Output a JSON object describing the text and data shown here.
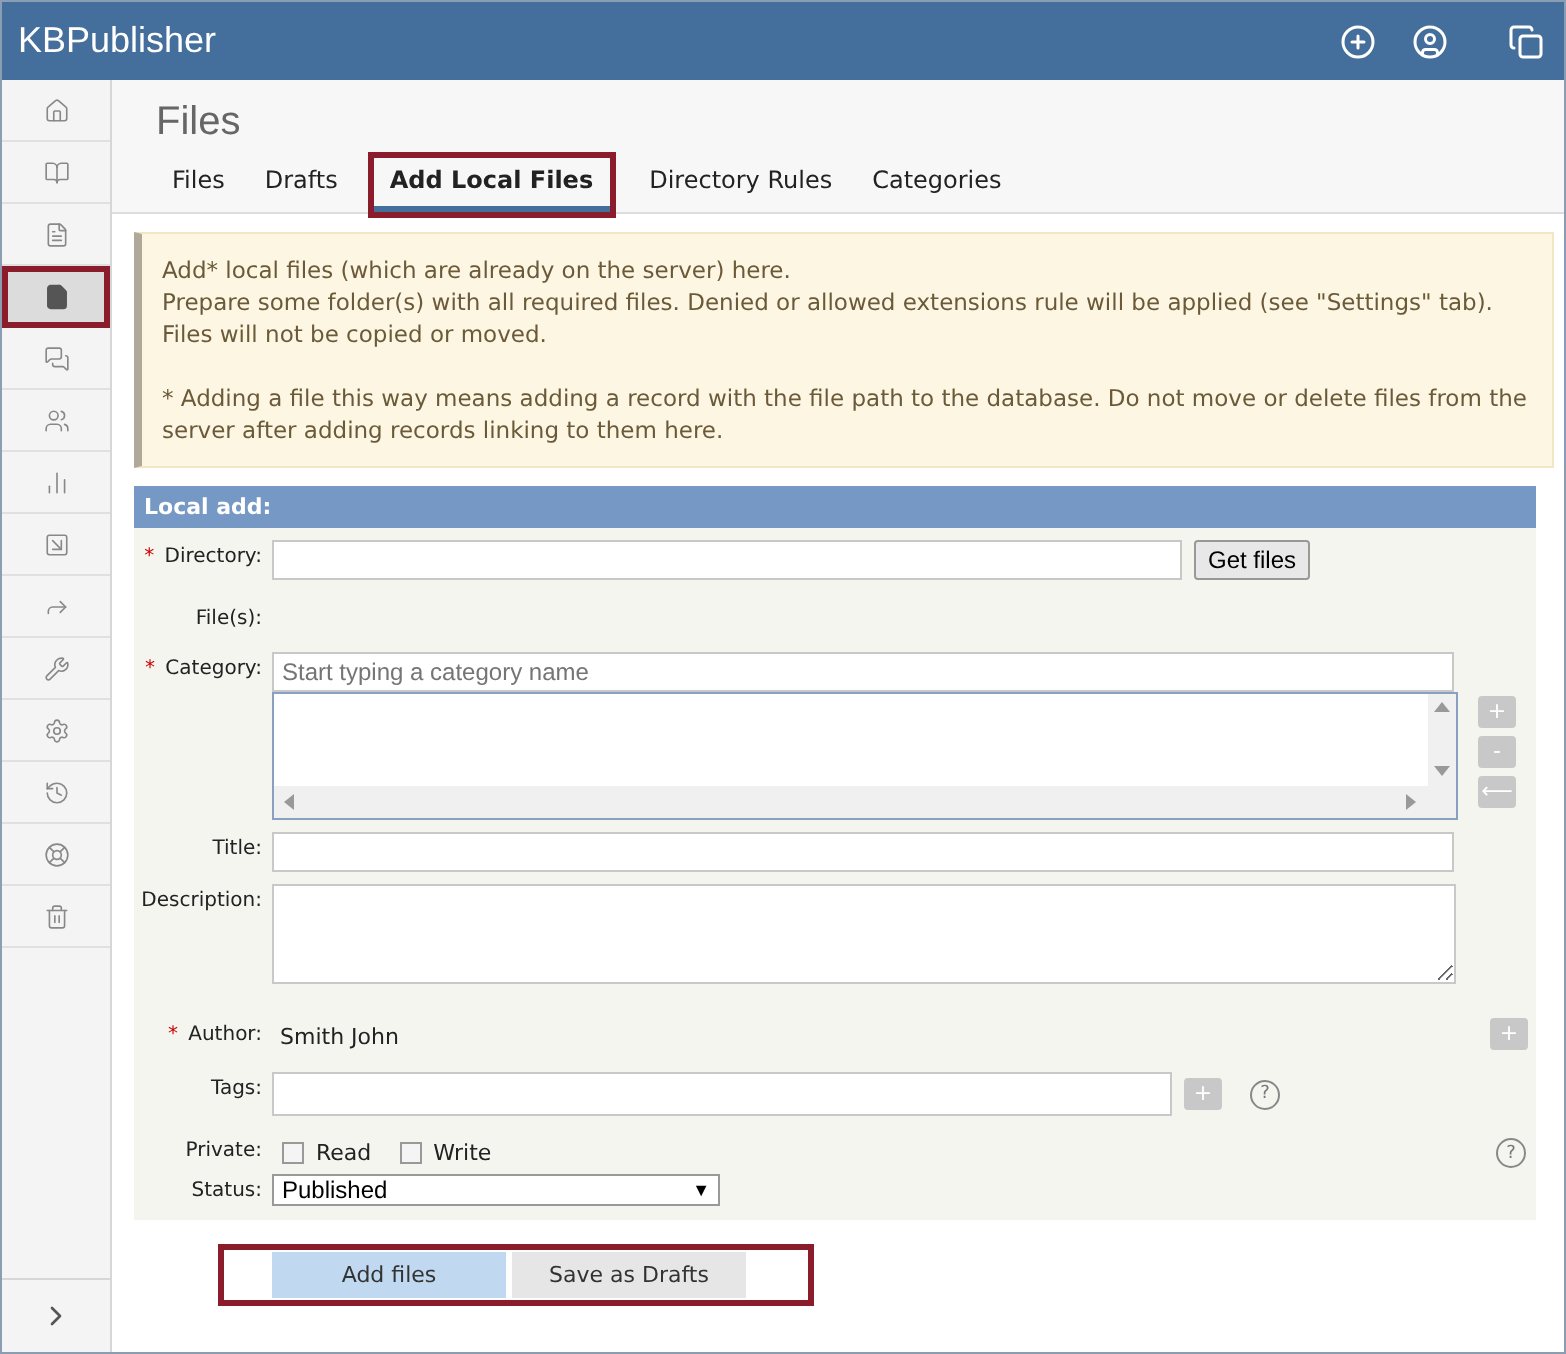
{
  "header": {
    "title": "KBPublisher"
  },
  "sidebar": {
    "items": [
      {
        "selected": false,
        "highlighted": false
      },
      {
        "selected": false,
        "highlighted": false
      },
      {
        "selected": false,
        "highlighted": false
      },
      {
        "selected": true,
        "highlighted": true
      },
      {
        "selected": false,
        "highlighted": false
      },
      {
        "selected": false,
        "highlighted": false
      },
      {
        "selected": false,
        "highlighted": false
      },
      {
        "selected": false,
        "highlighted": false
      },
      {
        "selected": false,
        "highlighted": false
      },
      {
        "selected": false,
        "highlighted": false
      },
      {
        "selected": false,
        "highlighted": false
      },
      {
        "selected": false,
        "highlighted": false
      },
      {
        "selected": false,
        "highlighted": false
      },
      {
        "selected": false,
        "highlighted": false
      }
    ]
  },
  "page_title": "Files",
  "tabs": [
    {
      "label": "Files",
      "selected": false,
      "highlighted": false
    },
    {
      "label": "Drafts",
      "selected": false,
      "highlighted": false
    },
    {
      "label": "Add Local Files",
      "selected": true,
      "highlighted": true
    },
    {
      "label": "Directory Rules",
      "selected": false,
      "highlighted": false
    },
    {
      "label": "Categories",
      "selected": false,
      "highlighted": false
    }
  ],
  "notice": {
    "paragraphs": [
      "Add* local files (which are already on the server) here.",
      "Prepare some folder(s) with all required files. Denied or allowed extensions rule will be applied (see \"Settings\" tab). Files will not be copied or moved.",
      "* Adding a file this way means adding a record with the file path to the database. Do not move or delete files from the server after adding records linking to them here."
    ]
  },
  "form": {
    "header": "Local add:",
    "required_mark": "*",
    "fields": [
      {
        "kind": "directory",
        "label": "Directory:",
        "required": true,
        "button": "Get files"
      },
      {
        "kind": "static",
        "label": "File(s):",
        "required": false
      },
      {
        "kind": "category",
        "label": "Category:",
        "required": true,
        "placeholder": "Start typing a category name",
        "side_buttons": [
          "+",
          "-",
          "⟵"
        ]
      },
      {
        "kind": "input",
        "label": "Title:",
        "required": false
      },
      {
        "kind": "textarea",
        "label": "Description:",
        "required": false
      },
      {
        "kind": "author",
        "label": "Author:",
        "required": true,
        "value": "Smith John",
        "button": "+"
      },
      {
        "kind": "tags",
        "label": "Tags:",
        "required": false,
        "button": "+",
        "help": "?"
      },
      {
        "kind": "checkboxes",
        "label": "Private:",
        "required": false,
        "options": [
          {
            "label": "Read",
            "checked": false
          },
          {
            "label": "Write",
            "checked": false
          }
        ],
        "help": "?"
      },
      {
        "kind": "select",
        "label": "Status:",
        "required": false,
        "value": "Published",
        "arrow": "▼"
      }
    ]
  },
  "actions": {
    "highlighted": true,
    "buttons": [
      {
        "label": "Add files",
        "primary": true
      },
      {
        "label": "Save as Drafts",
        "primary": false
      }
    ]
  }
}
